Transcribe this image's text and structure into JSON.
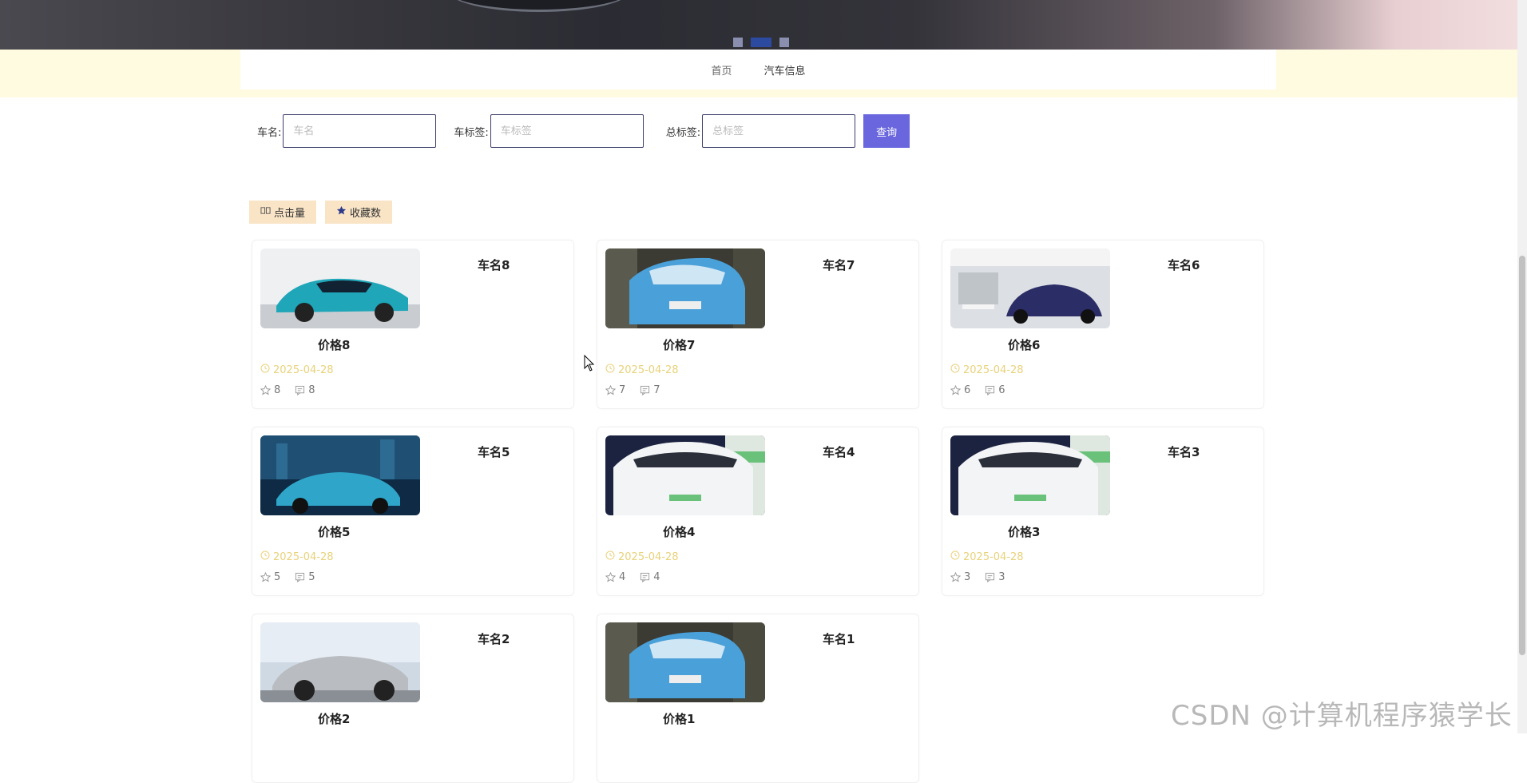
{
  "banner": {
    "dots": 3,
    "active_dot": 1
  },
  "nav": {
    "items": [
      {
        "label": "首页"
      },
      {
        "label": "汽车信息"
      }
    ]
  },
  "search": {
    "car_name_label": "车名:",
    "car_name_placeholder": "车名",
    "car_tag_label": "车标签:",
    "car_tag_placeholder": "车标签",
    "total_tag_label": "总标签:",
    "total_tag_placeholder": "总标签",
    "query_button": "查询"
  },
  "sort_buttons": {
    "clicks_label": "点击量",
    "favorites_label": "收藏数"
  },
  "cards": [
    {
      "name": "车名8",
      "price": "价格8",
      "date": "2025-04-28",
      "likes": "8",
      "comments": "8",
      "image": "teal-sedan"
    },
    {
      "name": "车名7",
      "price": "价格7",
      "date": "2025-04-28",
      "likes": "7",
      "comments": "7",
      "image": "blue-hatchback"
    },
    {
      "name": "车名6",
      "price": "价格6",
      "date": "2025-04-28",
      "likes": "6",
      "comments": "6",
      "image": "showroom-suv"
    },
    {
      "name": "车名5",
      "price": "价格5",
      "date": "2025-04-28",
      "likes": "5",
      "comments": "5",
      "image": "blue-suv-night"
    },
    {
      "name": "车名4",
      "price": "价格4",
      "date": "2025-04-28",
      "likes": "4",
      "comments": "4",
      "image": "white-ev"
    },
    {
      "name": "车名3",
      "price": "价格3",
      "date": "2025-04-28",
      "likes": "3",
      "comments": "3",
      "image": "white-ev"
    },
    {
      "name": "车名2",
      "price": "价格2",
      "date": "",
      "likes": "",
      "comments": "",
      "image": "silver-suv"
    },
    {
      "name": "车名1",
      "price": "价格1",
      "date": "",
      "likes": "",
      "comments": "",
      "image": "blue-hatchback"
    }
  ],
  "watermark": "CSDN @计算机程序猿学长",
  "colors": {
    "accent": "#6a67de",
    "sort_bg": "#f9e4c6",
    "nav_band": "#fffbe0",
    "date": "#e8d27a"
  }
}
